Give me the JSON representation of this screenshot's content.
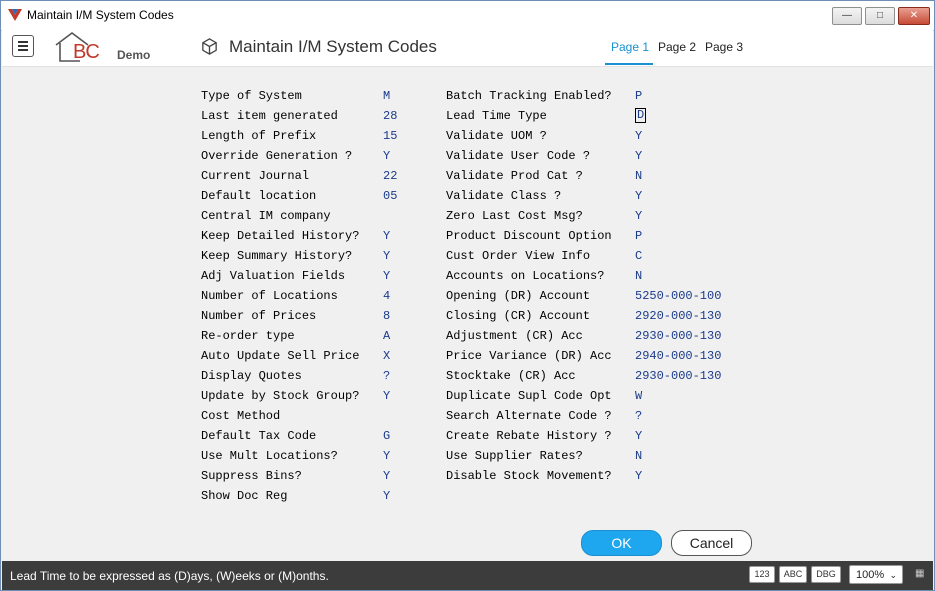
{
  "window": {
    "title": "Maintain I/M System Codes",
    "minimize": "—",
    "maximize": "□",
    "close": "✕"
  },
  "header": {
    "logo_letters": "BC",
    "demo_label": "Demo",
    "title": "Maintain I/M System Codes",
    "tabs": [
      {
        "label": "Page 1",
        "active": true
      },
      {
        "label": "Page 2"
      },
      {
        "label": "Page 3"
      }
    ]
  },
  "fields_left": [
    {
      "label": "Type of System",
      "value": "M"
    },
    {
      "label": "Last item generated",
      "value": "28"
    },
    {
      "label": "Length of Prefix",
      "value": "15"
    },
    {
      "label": "Override Generation ?",
      "value": "Y"
    },
    {
      "label": "Current Journal",
      "value": "22"
    },
    {
      "label": "Default location",
      "value": "05"
    },
    {
      "label": "Central IM company",
      "value": ""
    },
    {
      "label": "Keep Detailed History?",
      "value": "Y"
    },
    {
      "label": "Keep Summary History?",
      "value": "Y"
    },
    {
      "label": "Adj Valuation Fields",
      "value": "Y"
    },
    {
      "label": "Number of Locations",
      "value": "4"
    },
    {
      "label": "Number of Prices",
      "value": "8"
    },
    {
      "label": "Re-order type",
      "value": "A"
    },
    {
      "label": "Auto Update Sell Price",
      "value": "X"
    },
    {
      "label": "Display Quotes",
      "value": "?"
    },
    {
      "label": "Update by Stock Group?",
      "value": "Y"
    },
    {
      "label": "Cost Method",
      "value": ""
    },
    {
      "label": "Default Tax Code",
      "value": "G"
    },
    {
      "label": "Use Mult Locations?",
      "value": "Y"
    },
    {
      "label": "Suppress Bins?",
      "value": "Y"
    },
    {
      "label": "Show Doc Reg",
      "value": "Y"
    }
  ],
  "fields_right": [
    {
      "label": "Batch Tracking Enabled?",
      "value": "P"
    },
    {
      "label": "Lead Time Type",
      "value": "D"
    },
    {
      "label": "Validate UOM ?",
      "value": "Y"
    },
    {
      "label": "Validate User Code ?",
      "value": "Y"
    },
    {
      "label": "Validate Prod Cat ?",
      "value": "N"
    },
    {
      "label": "Validate Class ?",
      "value": "Y"
    },
    {
      "label": "Zero Last Cost Msg?",
      "value": "Y"
    },
    {
      "label": "Product Discount Option",
      "value": "P"
    },
    {
      "label": "Cust Order View Info",
      "value": "C"
    },
    {
      "label": "Accounts on Locations?",
      "value": "N"
    },
    {
      "label": "Opening (DR) Account",
      "value": "5250-000-100"
    },
    {
      "label": "Closing (CR) Account",
      "value": "2920-000-130"
    },
    {
      "label": "Adjustment (CR) Acc",
      "value": "2930-000-130"
    },
    {
      "label": "Price Variance (DR) Acc",
      "value": "2940-000-130"
    },
    {
      "label": "Stocktake (CR) Acc",
      "value": "2930-000-130"
    },
    {
      "label": "Duplicate Supl Code Opt",
      "value": "W"
    },
    {
      "label": "Search Alternate Code ?",
      "value": "?"
    },
    {
      "label": "Create Rebate History ?",
      "value": "Y"
    },
    {
      "label": "Use Supplier Rates?",
      "value": "N"
    },
    {
      "label": "Disable Stock Movement?",
      "value": "Y"
    }
  ],
  "buttons": {
    "ok": "OK",
    "cancel": "Cancel"
  },
  "status": {
    "message": "Lead Time to be expressed as (D)ays, (W)eeks or (M)onths.",
    "badges": [
      "123",
      "ABC",
      "DBG"
    ],
    "zoom": "100%"
  },
  "colors": {
    "accent": "#1ea6ef",
    "tab_active": "#1a8fd1",
    "status_bg": "#3c3c3c",
    "value_text": "#1a3a8a"
  }
}
